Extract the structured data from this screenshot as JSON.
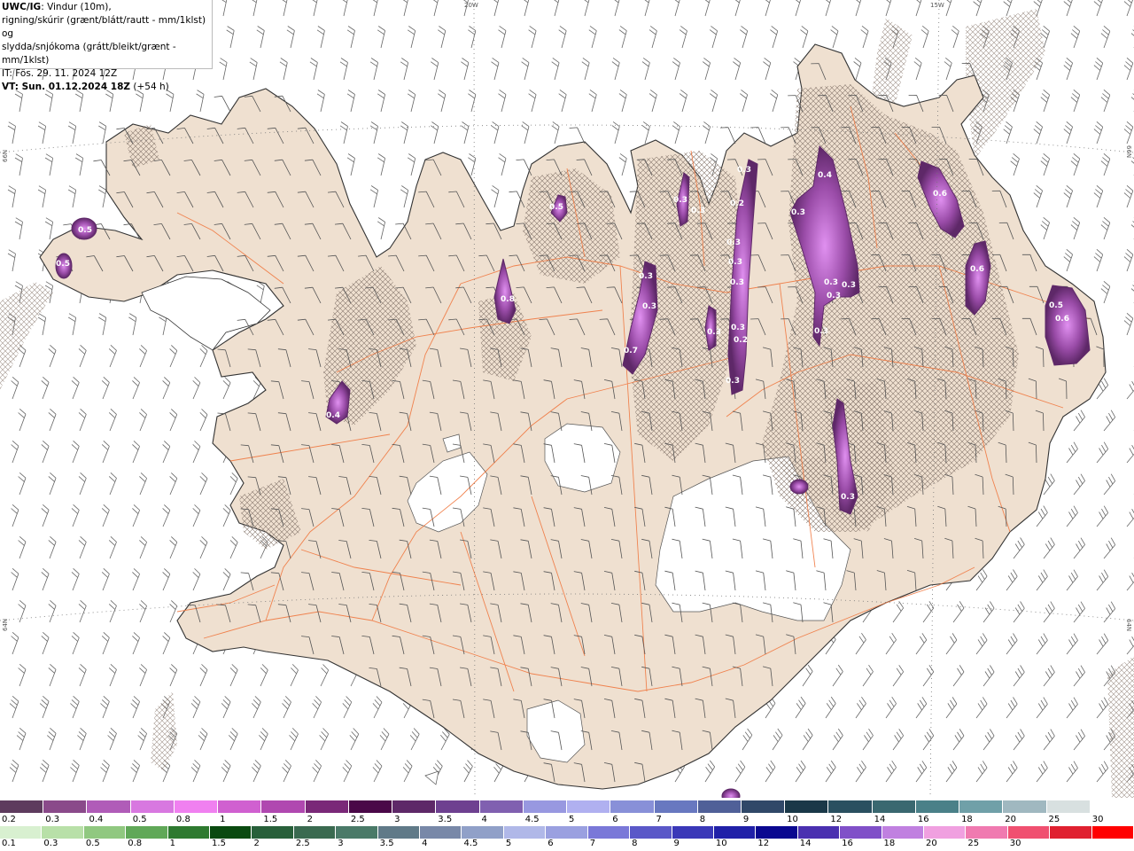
{
  "header": {
    "title_bold": "UWC/IG",
    "title_rest": ": Vindur (10m),",
    "line2": "rigning/skúrir (grænt/blátt/rautt - mm/1klst) og",
    "line3": "slydda/snjókoma (grátt/bleikt/grænt - mm/1klst)",
    "line4": "IT: Fös. 29. 11. 2024 12Z",
    "line5_bold": "VT: Sun. 01.12.2024 18Z",
    "line5_rest": " (+54 h)"
  },
  "graticule": {
    "top_20w": "20W",
    "top_15w": "15W",
    "left_66n": "66N",
    "right_66n": "66N",
    "left_64n": "64N",
    "right_64n": "64N"
  },
  "colors": {
    "land": "#efe0d0",
    "coast": "#333333",
    "roads": "#f07840",
    "snow_core": "#9a4ca8",
    "snow_edge": "#6a2a78"
  },
  "precip_labels": [
    {
      "text": "0.5"
    },
    {
      "text": "0.5"
    },
    {
      "text": "0.5"
    },
    {
      "text": "0.8"
    },
    {
      "text": "0.4"
    },
    {
      "text": "0.7"
    },
    {
      "text": "0.3"
    },
    {
      "text": "0.3"
    },
    {
      "text": "0.3"
    },
    {
      "text": "0.3"
    },
    {
      "text": "0.3"
    },
    {
      "text": "0.2"
    },
    {
      "text": "0.3"
    },
    {
      "text": "0.3"
    },
    {
      "text": "0.3"
    },
    {
      "text": "0.3"
    },
    {
      "text": "0.4"
    },
    {
      "text": "0.3"
    },
    {
      "text": "0.3"
    },
    {
      "text": "0.3"
    },
    {
      "text": "0.3"
    },
    {
      "text": "0.3"
    },
    {
      "text": "0.3"
    },
    {
      "text": "0.2"
    },
    {
      "text": "0.3"
    },
    {
      "text": "0.6"
    },
    {
      "text": "0.6"
    },
    {
      "text": "0.5"
    },
    {
      "text": "0.6"
    },
    {
      "text": "0.3"
    }
  ],
  "legend": {
    "snow_colors": [
      "#5e3b5e",
      "#8a4a8a",
      "#b05cb8",
      "#d878e0",
      "#f080f0",
      "#d060d0",
      "#b048b0",
      "#7a2878",
      "#4a0848",
      "#5e2868",
      "#6e4090",
      "#8060b0",
      "#9898e0",
      "#b0b0f0",
      "#8890d8",
      "#6878c0",
      "#506098",
      "#304868",
      "#1a3848",
      "#2a5060",
      "#3a6870",
      "#4a8088",
      "#70a0a8",
      "#a0b8c0",
      "#d8e0e0",
      "#ffffff"
    ],
    "snow_labels": [
      "0.2",
      "0.3",
      "0.4",
      "0.5",
      "0.8",
      "1",
      "1.5",
      "2",
      "2.5",
      "3",
      "3.5",
      "4",
      "4.5",
      "5",
      "6",
      "7",
      "8",
      "9",
      "10",
      "12",
      "14",
      "16",
      "18",
      "20",
      "25",
      "30"
    ],
    "rain_colors": [
      "#d8f0d0",
      "#b8e0a8",
      "#90c880",
      "#60a858",
      "#2e7a30",
      "#0a4a10",
      "#28603a",
      "#3a6a50",
      "#4a7a68",
      "#607a88",
      "#7888a8",
      "#90a0c8",
      "#b0b8e8",
      "#9aa0e0",
      "#7a78d8",
      "#5a58c8",
      "#3a38b8",
      "#2020a8",
      "#0a0890",
      "#4a30b0",
      "#8050c8",
      "#c080e0",
      "#f0a0e0",
      "#f07ab0",
      "#f05070",
      "#e02030",
      "#ff0000"
    ],
    "rain_labels": [
      "0.1",
      "0.3",
      "0.5",
      "0.8",
      "1",
      "1.5",
      "2",
      "2.5",
      "3",
      "3.5",
      "4",
      "4.5",
      "5",
      "6",
      "7",
      "8",
      "9",
      "10",
      "12",
      "14",
      "16",
      "18",
      "20",
      "25",
      "30"
    ]
  }
}
